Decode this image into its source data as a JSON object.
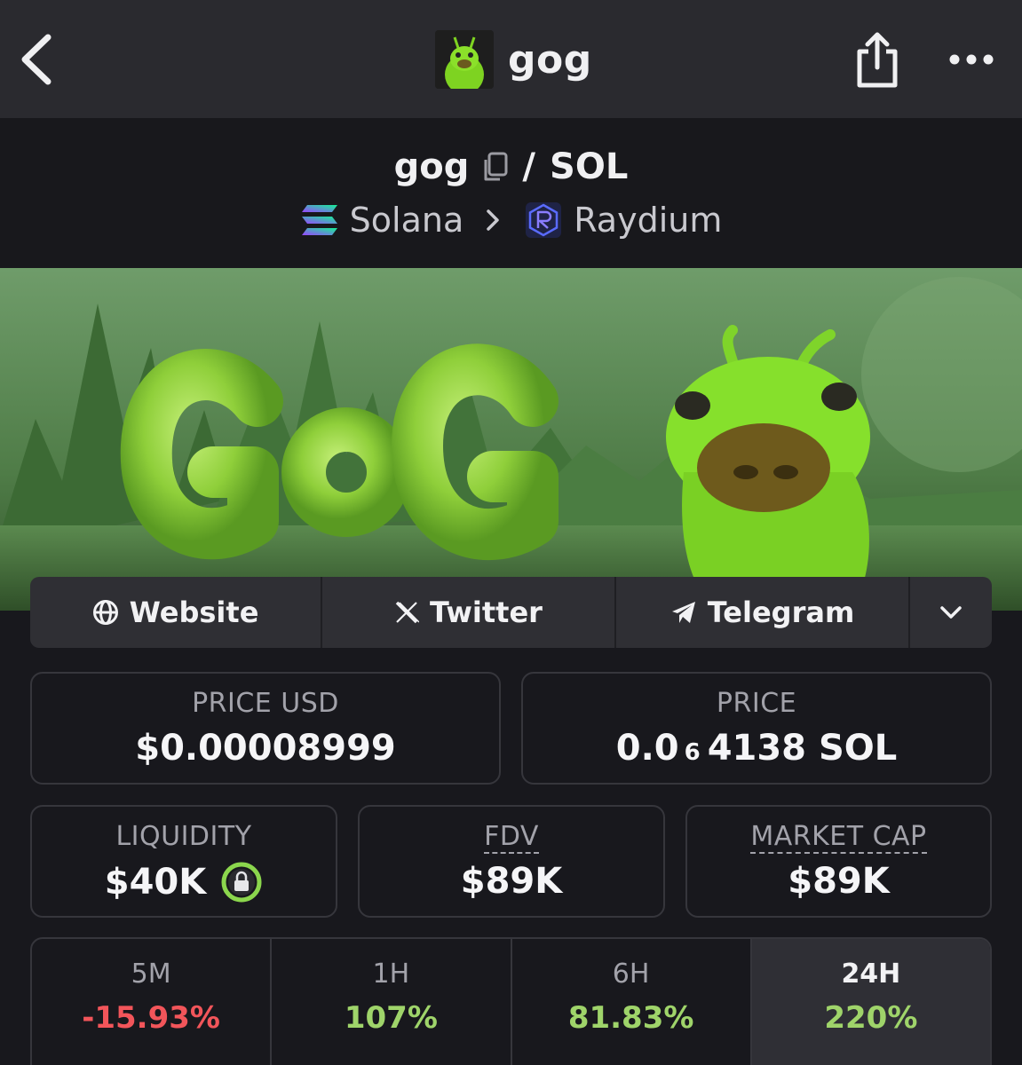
{
  "navbar": {
    "title": "gog",
    "back_icon": "chevron-left-icon",
    "share_icon": "share-icon",
    "more_icon": "more-horizontal-icon"
  },
  "pair": {
    "base": "gog",
    "separator": "/",
    "quote": "SOL",
    "chain": "Solana",
    "dex": "Raydium"
  },
  "links": [
    {
      "label": "Website",
      "icon": "globe-icon"
    },
    {
      "label": "Twitter",
      "icon": "x-logo-icon"
    },
    {
      "label": "Telegram",
      "icon": "telegram-icon"
    }
  ],
  "stats": {
    "price_usd": {
      "label": "PRICE USD",
      "value": "$0.00008999"
    },
    "price": {
      "label": "PRICE",
      "value_prefix": "0.0",
      "zero_count": "6",
      "value_suffix": "4138 SOL"
    },
    "liquidity": {
      "label": "LIQUIDITY",
      "value": "$40K"
    },
    "fdv": {
      "label": "FDV",
      "value": "$89K"
    },
    "market_cap": {
      "label": "MARKET CAP",
      "value": "$89K"
    }
  },
  "timeframes": [
    {
      "label": "5M",
      "value": "-15.93%",
      "direction": "down"
    },
    {
      "label": "1H",
      "value": "107%",
      "direction": "up"
    },
    {
      "label": "6H",
      "value": "81.83%",
      "direction": "up"
    },
    {
      "label": "24H",
      "value": "220%",
      "direction": "up",
      "active": true
    }
  ],
  "banner": {
    "text": "GoG"
  },
  "colors": {
    "negative": "#f2555a",
    "positive": "#9fd46a",
    "lock_badge": "#8bd64d"
  }
}
